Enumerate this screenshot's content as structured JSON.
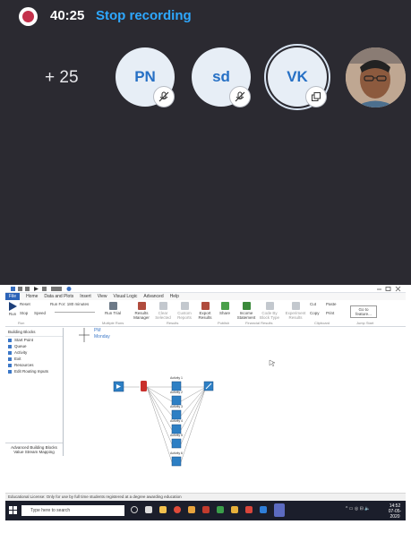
{
  "call": {
    "recording_time": "40:25",
    "stop_recording_label": "Stop recording",
    "more_participants": "+ 25",
    "participants": [
      {
        "initials": "PN",
        "state": "mic-off"
      },
      {
        "initials": "sd",
        "state": "mic-off"
      },
      {
        "initials": "VK",
        "state": "window"
      },
      {
        "initials": "",
        "state": "video"
      }
    ]
  },
  "desktop": {
    "app_menu": [
      "File",
      "Home",
      "Data and Plots",
      "Insert",
      "View",
      "Visual Logic",
      "Advanced",
      "Help"
    ],
    "ribbon": {
      "run": "Run",
      "reset": "Reset",
      "run_for": "Run For: 180 minutes",
      "stop": "Stop",
      "speed": "Speed",
      "run_trial": "Run Trial",
      "results_manager": "Results Manager",
      "clear_selected": "Clear Selected",
      "custom_reports": "Custom Reports",
      "export_results": "Export Results",
      "share": "Share",
      "income_statement": "Income Statement",
      "code_by_block_type": "Code By Block Type",
      "experiment_results": "Experiment Results",
      "cut": "Cut",
      "paste": "Paste",
      "copy": "Copy",
      "print": "Print",
      "go_to_feature": "Go to feature...",
      "groups": [
        "Run",
        "Multiple Runs",
        "Results",
        "Publish",
        "Financial Results",
        "Clipboard",
        "Jump Start"
      ]
    },
    "left_panel": {
      "header": "Building Blocks",
      "items": [
        "Start Point",
        "Queue",
        "Activity",
        "Exit",
        "Resources",
        "Edit Routing Inputs"
      ],
      "footer_1": "Advanced Building Blocks",
      "footer_2": "Value Stream Mapping"
    },
    "canvas": {
      "time_label": "PM",
      "day_label": "Monday",
      "activities": [
        "Activity 1",
        "Activity 2",
        "Activity 3",
        "Activity 4",
        "Activity 5",
        "Activity 6"
      ]
    },
    "status_text": "Educational License: Only for use by full time students registered at a degree awarding education",
    "taskbar": {
      "search_placeholder": "Type here to search",
      "time": "14:52",
      "date": "07-05-2020"
    }
  }
}
